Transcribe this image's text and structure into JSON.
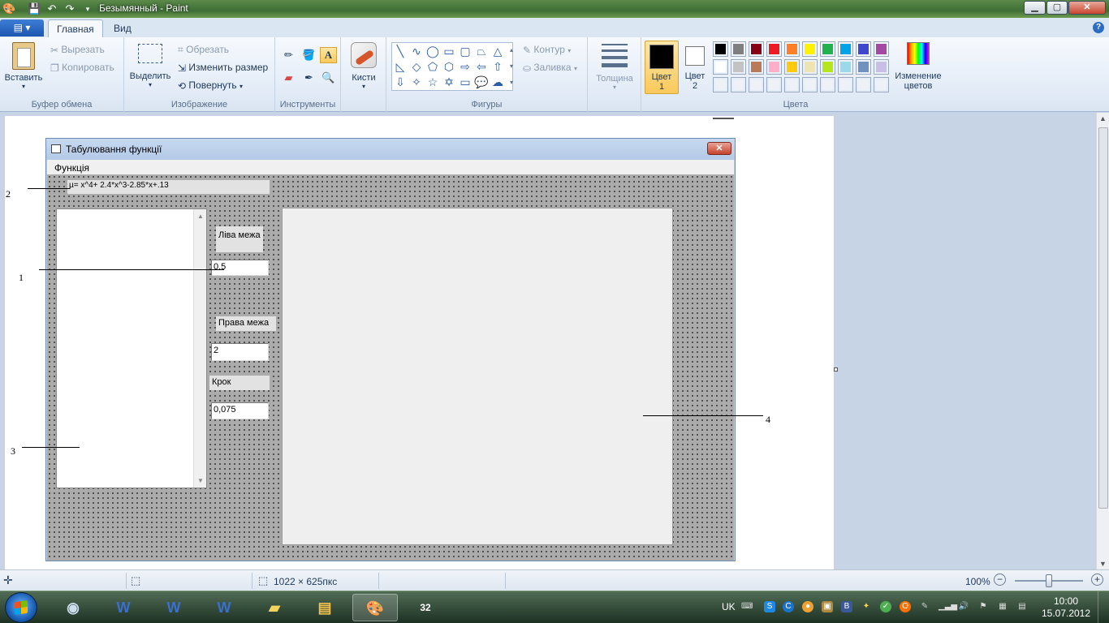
{
  "window": {
    "title": "Безымянный - Paint",
    "controls": {
      "minimize": "▁",
      "maximize": "▢",
      "close": "✕"
    }
  },
  "ribbon": {
    "tabs": [
      "Главная",
      "Вид"
    ],
    "app_menu_icon": "menu-icon",
    "clipboard": {
      "paste": "Вставить",
      "cut": "Вырезать",
      "copy": "Копировать",
      "label": "Буфер обмена"
    },
    "image": {
      "select": "Выделить",
      "crop": "Обрезать",
      "resize": "Изменить размер",
      "rotate": "Повернуть",
      "label": "Изображение"
    },
    "tools": {
      "label": "Инструменты"
    },
    "brushes": {
      "label": "Кисти"
    },
    "shapes": {
      "outline": "Контур",
      "fill": "Заливка",
      "label": "Фигуры"
    },
    "size": {
      "label": "Толщина"
    },
    "color1": {
      "label_top": "Цвет",
      "label_bottom": "1"
    },
    "color2": {
      "label_top": "Цвет",
      "label_bottom": "2"
    },
    "colors": {
      "label": "Цвета",
      "edit_top": "Изменение",
      "edit_bottom": "цветов",
      "palette_row1": [
        "#000000",
        "#7f7f7f",
        "#880015",
        "#ed1c24",
        "#ff7f27",
        "#fff200",
        "#22b14c",
        "#00a2e8",
        "#3f48cc",
        "#a349a4"
      ],
      "palette_row2": [
        "#ffffff",
        "#c3c3c3",
        "#b97a57",
        "#ffaec9",
        "#ffc90e",
        "#efe4b0",
        "#b5e61d",
        "#99d9ea",
        "#7092be",
        "#c8bfe7"
      ]
    }
  },
  "form": {
    "title": "Табулювання функції",
    "menu": "Функція",
    "function_text": "µ= x^4+ 2.4*x^3-2.85*x+.13",
    "left_label": "Ліва межа",
    "left_value": "0.5",
    "right_label": "Права межа",
    "right_value": "2",
    "step_label": "Крок",
    "step_value": "0,075"
  },
  "annotations": {
    "n1": "1",
    "n2": "2",
    "n3": "3",
    "n4": "4"
  },
  "status": {
    "image_size": "1022 × 625пкс",
    "zoom": "100%",
    "zoom_minus": "−",
    "zoom_plus": "+"
  },
  "taskbar": {
    "language": "UK",
    "time": "10:00",
    "date": "15.07.2012"
  }
}
